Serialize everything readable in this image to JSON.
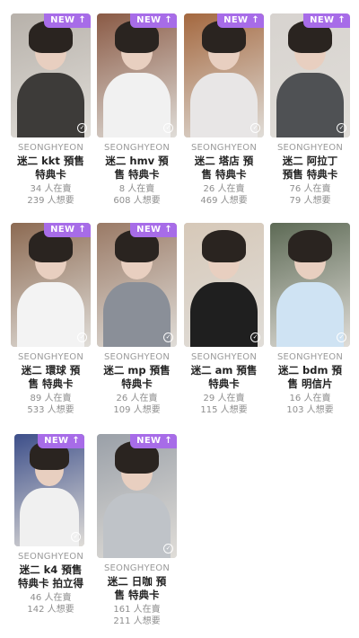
{
  "products": [
    {
      "artist": "SEONGHYEON",
      "title_line1": "迷二 kkt 預售",
      "title_line2": "特典卡",
      "selling": "34 人在賣",
      "wanting": "239 人想要",
      "badge": "NEW",
      "bg": "#b7b1aa",
      "body_color": "#3d3b39"
    },
    {
      "artist": "SEONGHYEON",
      "title_line1": "迷二 hmv 預",
      "title_line2": "售 特典卡",
      "selling": "8 人在賣",
      "wanting": "608 人想要",
      "badge": "NEW",
      "bg": "#8a5a45",
      "body_color": "#f1f1f1"
    },
    {
      "artist": "SEONGHYEON",
      "title_line1": "迷二 塔店 預",
      "title_line2": "售 特典卡",
      "selling": "26 人在賣",
      "wanting": "469 人想要",
      "badge": "NEW",
      "bg": "#a4683f",
      "body_color": "#e8e6e6"
    },
    {
      "artist": "SEONGHYEON",
      "title_line1": "迷二 阿拉丁",
      "title_line2": "預售 特典卡",
      "selling": "76 人在賣",
      "wanting": "79 人想要",
      "badge": "NEW",
      "bg": "#d7d3cf",
      "body_color": "#4f5154"
    },
    {
      "artist": "SEONGHYEON",
      "title_line1": "迷二 環球 預",
      "title_line2": "售 特典卡",
      "selling": "89 人在賣",
      "wanting": "533 人想要",
      "badge": "NEW",
      "bg": "#8c6a52",
      "body_color": "#f3f3f3"
    },
    {
      "artist": "SEONGHYEON",
      "title_line1": "迷二 mp 預售",
      "title_line2": "特典卡",
      "selling": "26 人在賣",
      "wanting": "109 人想要",
      "badge": "NEW",
      "bg": "#9a7a66",
      "body_color": "#8a8f98"
    },
    {
      "artist": "SEONGHYEON",
      "title_line1": "迷二 am 預售",
      "title_line2": "特典卡",
      "selling": "29 人在賣",
      "wanting": "115 人想要",
      "badge": "",
      "bg": "#d6c8b8",
      "body_color": "#1f1f1f"
    },
    {
      "artist": "SEONGHYEON",
      "title_line1": "迷二 bdm 預",
      "title_line2": "售 明信片",
      "selling": "16 人在賣",
      "wanting": "103 人想要",
      "badge": "",
      "bg": "#5d6a55",
      "body_color": "#cfe3f3"
    },
    {
      "artist": "SEONGHYEON",
      "title_line1": "迷二 k4 預售",
      "title_line2": "特典卡 拍立得",
      "selling": "46 人在賣",
      "wanting": "142 人想要",
      "badge": "NEW",
      "bg": "#3d4f8a",
      "body_color": "#f0f0f0"
    },
    {
      "artist": "SEONGHYEON",
      "title_line1": "迷二 日咖 預",
      "title_line2": "售 特典卡",
      "selling": "161 人在賣",
      "wanting": "211 人想要",
      "badge": "NEW",
      "bg": "#9aa0a8",
      "body_color": "#bfc3c8"
    }
  ],
  "icons": {
    "badge_arrow": "arrow-up-icon",
    "owned": "check-circle-icon"
  },
  "colors": {
    "badge": "#a76ce8",
    "artist": "#9a9a9a",
    "title": "#222222",
    "stat": "#8e8e8e"
  }
}
